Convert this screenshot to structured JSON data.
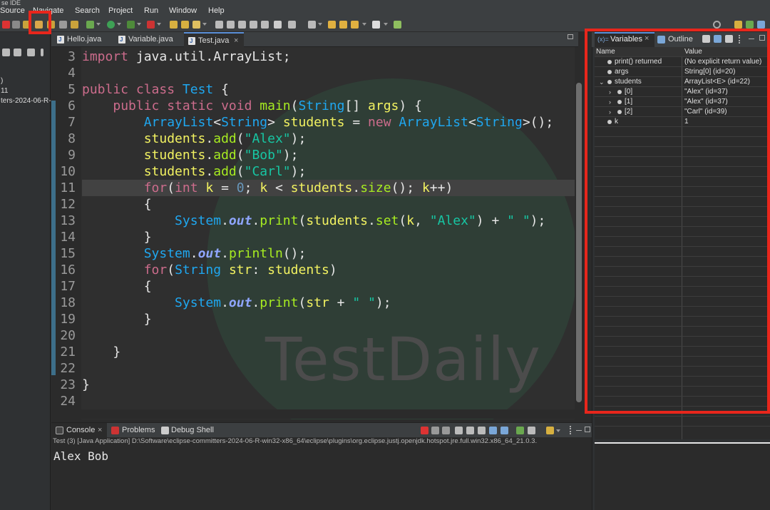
{
  "window": {
    "title_fragment": "se IDE"
  },
  "menu": [
    "Source",
    "Navigate",
    "Search",
    "Project",
    "Run",
    "Window",
    "Help"
  ],
  "left_panel": {
    "lines": [
      ")",
      "11",
      "ters-2024-06-R-"
    ]
  },
  "editor_tabs": [
    {
      "label": "Hello.java",
      "active": false
    },
    {
      "label": "Variable.java",
      "active": false
    },
    {
      "label": "Test.java",
      "active": true
    }
  ],
  "code": {
    "highlight_line": 11,
    "lines": [
      {
        "n": "3",
        "html": "<span class=\"kw\">import</span> java.util.ArrayList;"
      },
      {
        "n": "4",
        "html": ""
      },
      {
        "n": "5",
        "html": "<span class=\"kw\">public class</span> <span class=\"ty\">Test</span> {"
      },
      {
        "n": "6",
        "html": "    <span class=\"kw\">public static void</span> <span class=\"fn\">main</span>(<span class=\"ty\">String</span>[] <span class=\"vr\">args</span>) {"
      },
      {
        "n": "7",
        "html": "        <span class=\"ty\">ArrayList</span>&lt;<span class=\"ty\">String</span>&gt; <span class=\"vr\">students</span> = <span class=\"kw\">new</span> <span class=\"ty\">ArrayList</span>&lt;<span class=\"ty\">String</span>&gt;();"
      },
      {
        "n": "8",
        "html": "        <span class=\"vr\">students</span>.<span class=\"fn\">add</span>(<span class=\"st\">\"Alex\"</span>);"
      },
      {
        "n": "9",
        "html": "        <span class=\"vr\">students</span>.<span class=\"fn\">add</span>(<span class=\"st\">\"Bob\"</span>);"
      },
      {
        "n": "10",
        "html": "        <span class=\"vr\">students</span>.<span class=\"fn\">add</span>(<span class=\"st\">\"Carl\"</span>);"
      },
      {
        "n": "11",
        "html": "        <span class=\"kw\">for</span>(<span class=\"kw\">int</span> <span class=\"vr\">k</span> = <span class=\"nm\">0</span>; <span class=\"vr\">k</span> &lt; <span class=\"vr\">students</span>.<span class=\"fn\">size</span>(); <span class=\"vr\">k</span>++)"
      },
      {
        "n": "12",
        "html": "        {"
      },
      {
        "n": "13",
        "html": "            <span class=\"ty\">System</span>.<span class=\"ou\">out</span>.<span class=\"fn\">print</span>(<span class=\"vr\">students</span>.<span class=\"fn\">set</span>(<span class=\"vr\">k</span>, <span class=\"st\">\"Alex\"</span>) + <span class=\"st\">\" \"</span>);"
      },
      {
        "n": "14",
        "html": "        }"
      },
      {
        "n": "15",
        "html": "        <span class=\"ty\">System</span>.<span class=\"ou\">out</span>.<span class=\"fn\">println</span>();"
      },
      {
        "n": "16",
        "html": "        <span class=\"kw\">for</span>(<span class=\"ty\">String</span> <span class=\"vr\">str</span>: <span class=\"vr\">students</span>)"
      },
      {
        "n": "17",
        "html": "        {"
      },
      {
        "n": "18",
        "html": "            <span class=\"ty\">System</span>.<span class=\"ou\">out</span>.<span class=\"fn\">print</span>(<span class=\"vr\">str</span> + <span class=\"st\">\" \"</span>);"
      },
      {
        "n": "19",
        "html": "        }"
      },
      {
        "n": "20",
        "html": ""
      },
      {
        "n": "21",
        "html": "    }"
      },
      {
        "n": "22",
        "html": ""
      },
      {
        "n": "23",
        "html": "}"
      },
      {
        "n": "24",
        "html": ""
      }
    ]
  },
  "watermark": {
    "text": "TestDaily"
  },
  "console": {
    "tabs": [
      {
        "label": "Console"
      },
      {
        "label": "Problems"
      },
      {
        "label": "Debug Shell"
      }
    ],
    "header": "Test (3) [Java Application] D:\\Software\\eclipse-committers-2024-06-R-win32-x86_64\\eclipse\\plugins\\org.eclipse.justj.openjdk.hotspot.jre.full.win32.x86_64_21.0.3.",
    "output": "Alex Bob"
  },
  "variables_panel": {
    "tabs": [
      {
        "label": "Variables"
      },
      {
        "label": "Outline"
      }
    ],
    "columns": [
      "Name",
      "Value"
    ],
    "rows": [
      {
        "name": "print() returned",
        "value": "(No explicit return value)",
        "indent": 0,
        "expand": false
      },
      {
        "name": "args",
        "value": "String[0]  (id=20)",
        "indent": 0,
        "expand": false
      },
      {
        "name": "students",
        "value": "ArrayList<E>  (id=22)",
        "indent": 0,
        "expand": "open"
      },
      {
        "name": "[0]",
        "value": "\"Alex\" (id=37)",
        "indent": 1,
        "expand": "closed"
      },
      {
        "name": "[1]",
        "value": "\"Alex\" (id=37)",
        "indent": 1,
        "expand": "closed"
      },
      {
        "name": "[2]",
        "value": "\"Carl\" (id=39)",
        "indent": 1,
        "expand": "closed"
      },
      {
        "name": "k",
        "value": "1",
        "indent": 0,
        "expand": false
      }
    ]
  },
  "colors": {
    "highlight_box": "#e8261c",
    "keyword": "#cc6c8c",
    "type": "#1fa7f0",
    "string": "#17c6a3"
  }
}
